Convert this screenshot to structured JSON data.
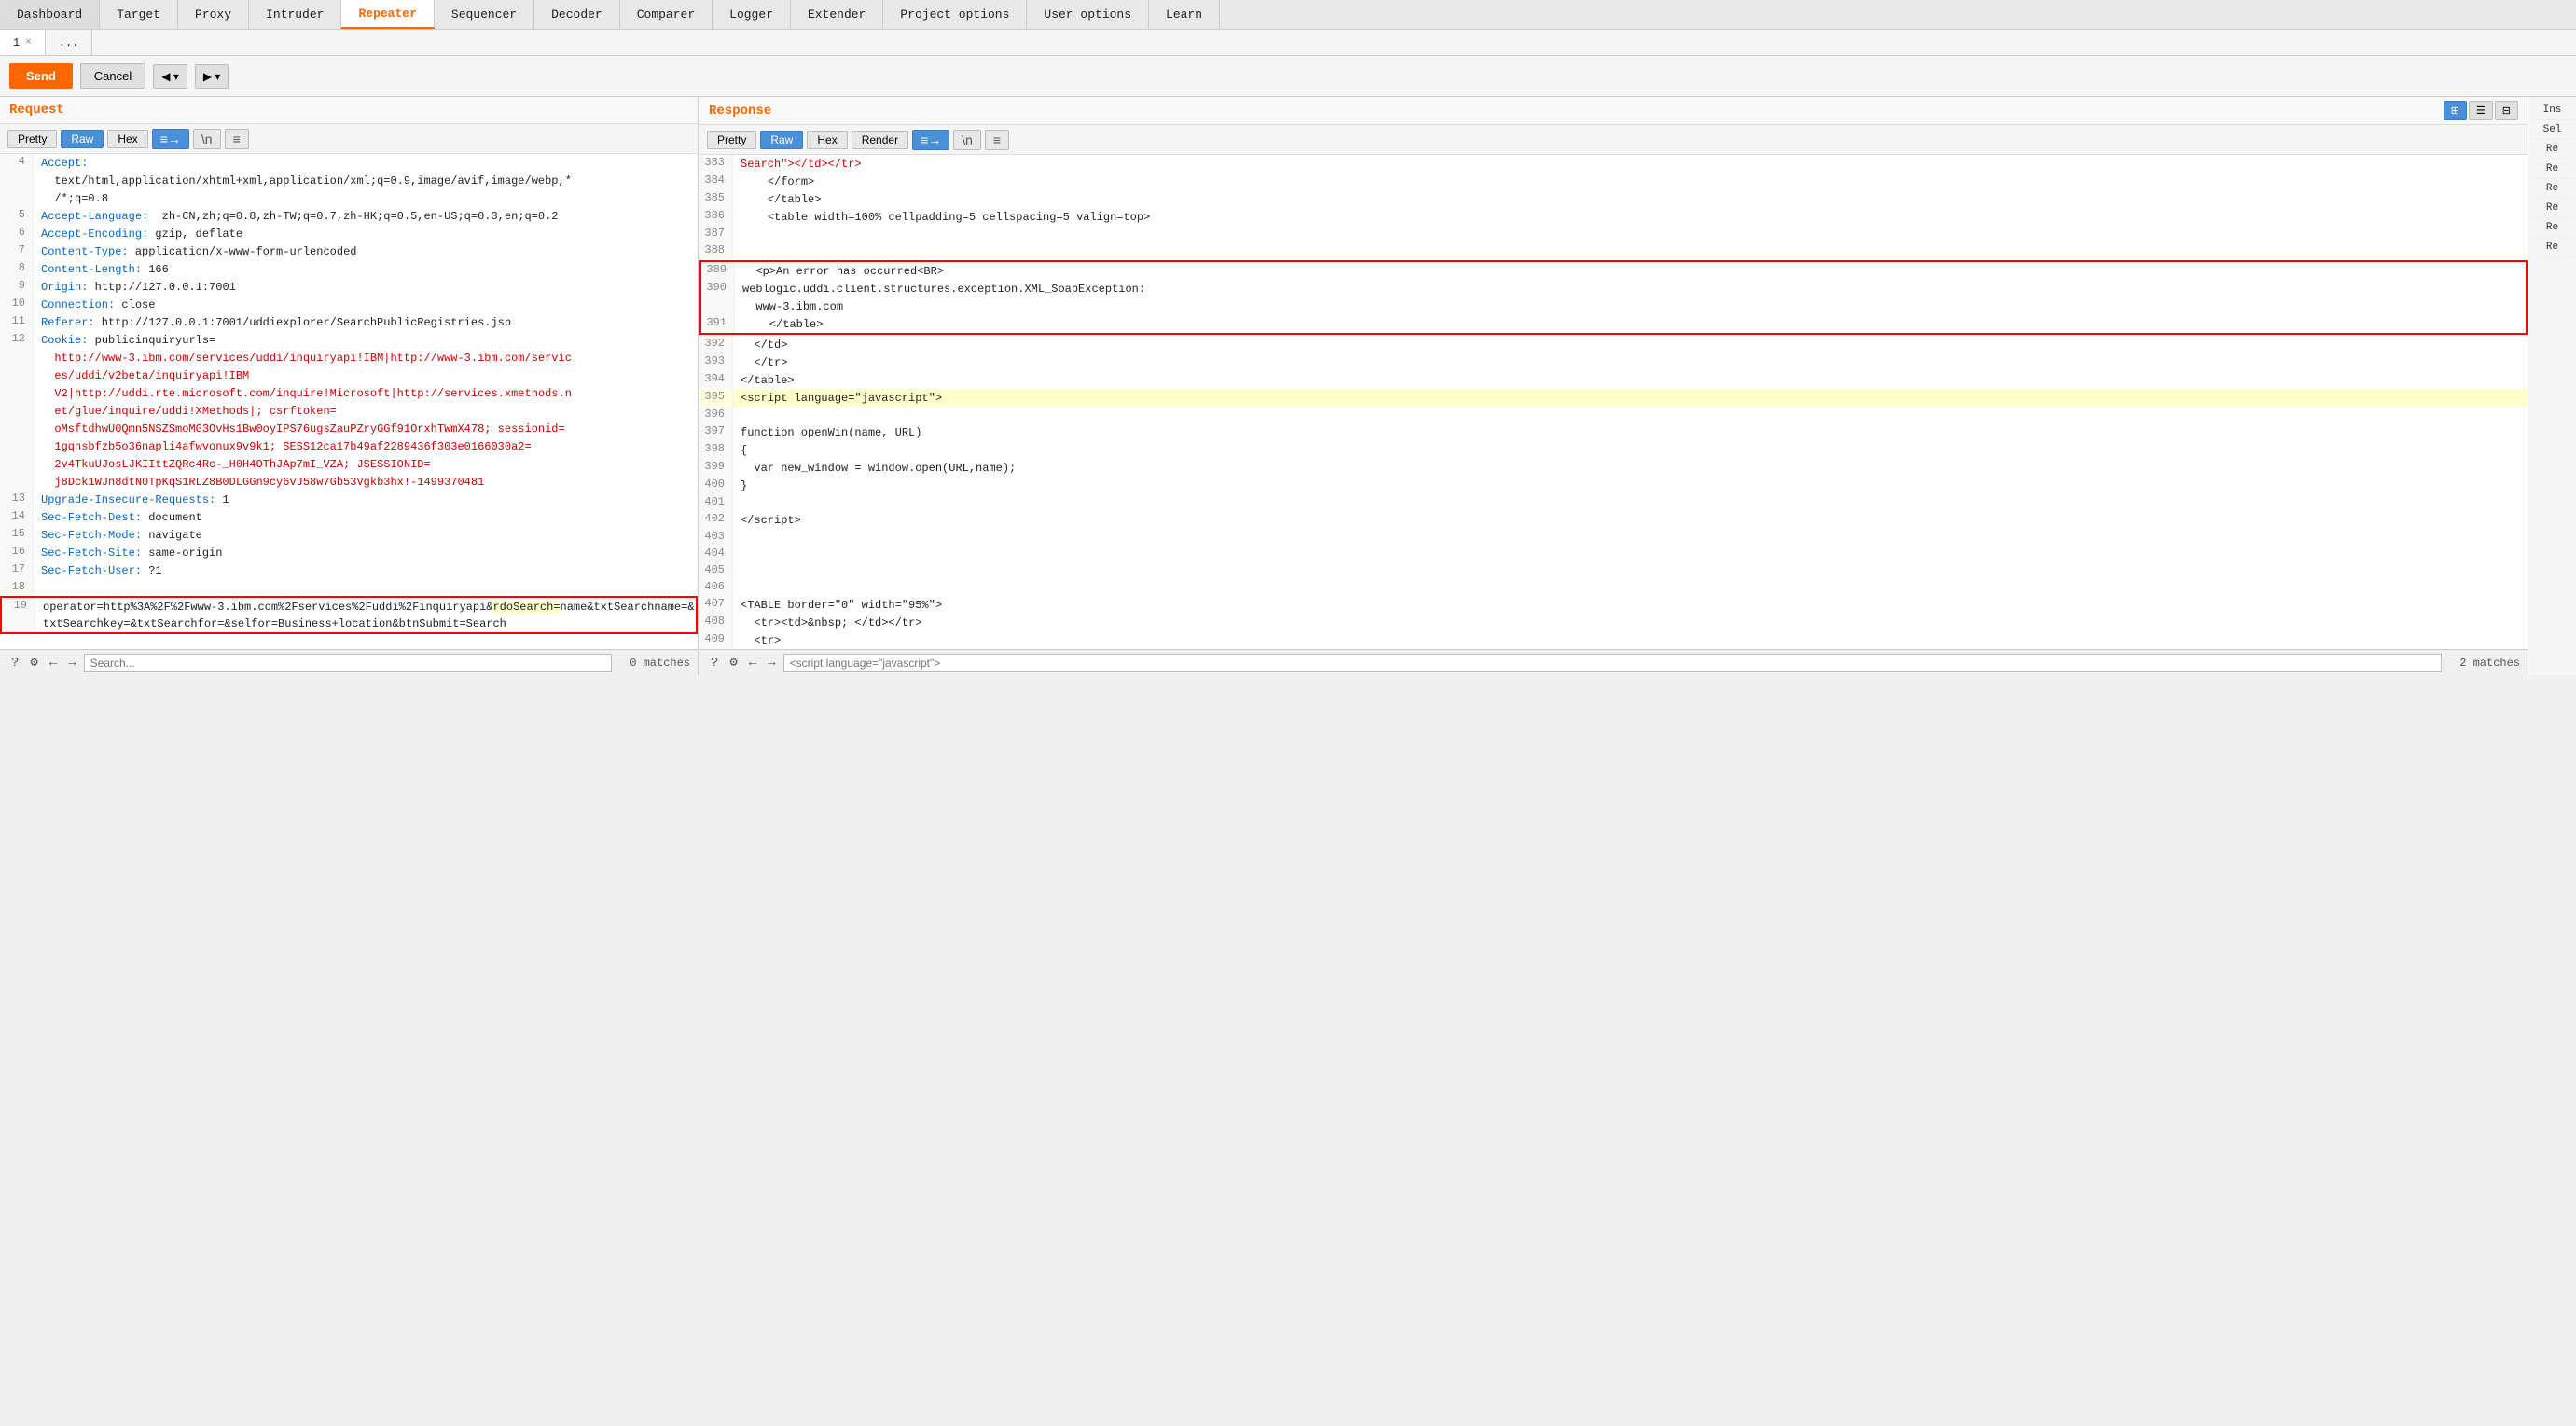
{
  "nav": {
    "items": [
      "Dashboard",
      "Target",
      "Proxy",
      "Intruder",
      "Repeater",
      "Sequencer",
      "Decoder",
      "Comparer",
      "Logger",
      "Extender",
      "Project options",
      "User options",
      "Learn"
    ],
    "active": "Repeater"
  },
  "tabs": [
    {
      "label": "1",
      "close": "×",
      "active": true
    },
    {
      "label": "...",
      "close": "",
      "active": false
    }
  ],
  "toolbar": {
    "send": "Send",
    "cancel": "Cancel",
    "back": "◀",
    "forward": "▶"
  },
  "request_panel": {
    "title": "Request",
    "buttons": [
      "Pretty",
      "Raw",
      "Hex"
    ],
    "active_btn": "Raw",
    "icons": [
      "≡→",
      "\\n",
      "≡"
    ],
    "lines": [
      {
        "num": 4,
        "content": "Accept:",
        "type": "key"
      },
      {
        "num": "",
        "content": "  text/html,application/xhtml+xml,application/xml;q=0.9,image/avif,image/webp,*",
        "type": "value"
      },
      {
        "num": "",
        "content": "  /*;q=0.8",
        "type": "value"
      },
      {
        "num": 5,
        "content": "Accept-Language: zh-CN,zh;q=0.8,zh-TW;q=0.7,zh-HK;q=0.5,en-US;q=0.3,en;q=0.2",
        "type": "key_value"
      },
      {
        "num": 6,
        "content": "Accept-Encoding: gzip, deflate",
        "type": "key_value"
      },
      {
        "num": 7,
        "content": "Content-Type: application/x-www-form-urlencoded",
        "type": "key_value"
      },
      {
        "num": 8,
        "content": "Content-Length: 166",
        "type": "key_value"
      },
      {
        "num": 9,
        "content": "Origin: http://127.0.0.1:7001",
        "type": "key_value"
      },
      {
        "num": 10,
        "content": "Connection: close",
        "type": "key_value"
      },
      {
        "num": 11,
        "content": "Referer: http://127.0.0.1:7001/uddiexplorer/SearchPublicRegistries.jsp",
        "type": "key_value"
      },
      {
        "num": 12,
        "content": "Cookie: publicinquiryurls=",
        "type": "key"
      },
      {
        "num": "",
        "content": "  http://www-3.ibm.com/services/uddi/inquiryapi!IBM|http://www-3.ibm.com/servic",
        "type": "value_red"
      },
      {
        "num": "",
        "content": "  es/uddi/v2beta/inquiryapi!IBM",
        "type": "value_red"
      },
      {
        "num": "",
        "content": "  V2|http://uddi.rte.microsoft.com/inquire!Microsoft|http://services.xmethods.n",
        "type": "value_red"
      },
      {
        "num": "",
        "content": "  et/glue/inquire/uddi!XMethods|; csrftoken=",
        "type": "value_red"
      },
      {
        "num": "",
        "content": "  oMsftdhwU0Qmn5NSZSmoMG3OvHs1Bw0oyIPS76ugsZauPZryGGf91OrxhTWmX478; sessionid=",
        "type": "value_red"
      },
      {
        "num": "",
        "content": "  1gqnsbfzb5o36napli4afwvonux9v9k1; SESS12ca17b49af2289436f303e0166030a2=",
        "type": "value_red"
      },
      {
        "num": "",
        "content": "  2v4TkuUJosLJKIIttZQRc4Rc-_H0H4OThJAp7mI_VZA; JSESSIONID=",
        "type": "value_red"
      },
      {
        "num": "",
        "content": "  j8Dck1WJn8dtN0TpKqS1RLZ8B0DLGGn9cy6vJ58w7Gb53Vgkb3hx!-1499370481",
        "type": "value_red"
      },
      {
        "num": 13,
        "content": "Upgrade-Insecure-Requests: 1",
        "type": "key_value"
      },
      {
        "num": 14,
        "content": "Sec-Fetch-Dest: document",
        "type": "key_value"
      },
      {
        "num": 15,
        "content": "Sec-Fetch-Mode: navigate",
        "type": "key_value"
      },
      {
        "num": 16,
        "content": "Sec-Fetch-Site: same-origin",
        "type": "key_value"
      },
      {
        "num": 17,
        "content": "Sec-Fetch-User: ?1",
        "type": "key_value"
      },
      {
        "num": 18,
        "content": "",
        "type": "empty"
      },
      {
        "num": 19,
        "content": "operator=http%3A%2F%2Fwww-3.ibm.com%2Fservices%2Fuddi%2Finquiryapi&rdoSearch=name&txtSearchname=&txtSearchkey=&txtSearchfor=&selfor=Business+location&btnSubmit=Search",
        "type": "body_red"
      }
    ]
  },
  "response_panel": {
    "title": "Response",
    "buttons": [
      "Pretty",
      "Raw",
      "Hex",
      "Render"
    ],
    "active_btn": "Raw",
    "icons": [
      "≡→",
      "\\n",
      "≡"
    ],
    "lines": [
      {
        "num": 383,
        "content": "Search\"><\\/td><\\/tr>",
        "type": "normal"
      },
      {
        "num": 384,
        "content": "    <\\/form>",
        "type": "normal"
      },
      {
        "num": 385,
        "content": "    <\\/table>",
        "type": "normal"
      },
      {
        "num": 386,
        "content": "    <table width=100% cellpadding=5 cellspacing=5 valign=top>",
        "type": "normal"
      },
      {
        "num": 387,
        "content": "",
        "type": "empty"
      },
      {
        "num": 388,
        "content": "",
        "type": "empty_red"
      },
      {
        "num": 389,
        "content": "  <p>An error has occurred<BR>",
        "type": "red_box_start"
      },
      {
        "num": 390,
        "content": "weblogic.uddi.client.structures.exception.XML_SoapException:",
        "type": "red_box_mid"
      },
      {
        "num": "",
        "content": "  www-3.ibm.com",
        "type": "red_box_mid"
      },
      {
        "num": 391,
        "content": "    <\\/table>",
        "type": "red_box_end"
      },
      {
        "num": 392,
        "content": "  <\\/td>",
        "type": "normal"
      },
      {
        "num": 393,
        "content": "  <\\/tr>",
        "type": "normal"
      },
      {
        "num": 394,
        "content": "<\\/table>",
        "type": "normal"
      },
      {
        "num": 395,
        "content": "<script language=\"javascript\">",
        "type": "yellow_highlight"
      },
      {
        "num": 396,
        "content": "",
        "type": "empty"
      },
      {
        "num": 397,
        "content": "function openWin(name, URL)",
        "type": "normal"
      },
      {
        "num": 398,
        "content": "{",
        "type": "normal"
      },
      {
        "num": 399,
        "content": "  var new_window = window.open(URL,name);",
        "type": "normal"
      },
      {
        "num": 400,
        "content": "}",
        "type": "normal"
      },
      {
        "num": 401,
        "content": "",
        "type": "empty"
      },
      {
        "num": 402,
        "content": "<\\/script>",
        "type": "normal"
      },
      {
        "num": 403,
        "content": "",
        "type": "empty"
      },
      {
        "num": 404,
        "content": "",
        "type": "empty"
      },
      {
        "num": 405,
        "content": "",
        "type": "empty"
      },
      {
        "num": 406,
        "content": "",
        "type": "empty"
      },
      {
        "num": 407,
        "content": "<TABLE border=\"0\" width=\"95%\">",
        "type": "normal"
      },
      {
        "num": 408,
        "content": "  <tr><td>&nbsp; <\\/td><\\/tr>",
        "type": "normal"
      },
      {
        "num": 409,
        "content": "  <tr>",
        "type": "normal"
      }
    ]
  },
  "ins_panel": {
    "title": "Ins",
    "items": [
      "Sel",
      "Re",
      "Re",
      "Re",
      "Re",
      "Re",
      "Re"
    ]
  },
  "bottom_left": {
    "search_placeholder": "Search...",
    "matches": "0 matches"
  },
  "bottom_right": {
    "search_value": "<script language=\"javascript\">",
    "matches": "2 matches"
  },
  "view_buttons": {
    "grid": "⊞",
    "rows": "☰",
    "cols": "⊟"
  }
}
